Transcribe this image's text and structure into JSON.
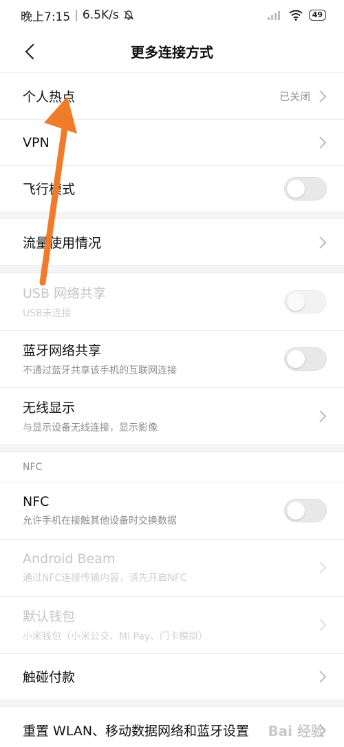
{
  "status_bar": {
    "time": "晚上7:15",
    "separator": "|",
    "speed": "6.5K/s",
    "battery": "49",
    "icons": [
      "mute-bell-icon",
      "signal-icon",
      "wifi-icon",
      "battery-icon"
    ]
  },
  "header": {
    "title": "更多连接方式",
    "back_icon": "back-arrow-icon"
  },
  "group1": {
    "hotspot": {
      "label": "个人热点",
      "value": "已关闭"
    },
    "vpn": {
      "label": "VPN"
    },
    "airplane": {
      "label": "飞行模式",
      "enabled": false
    }
  },
  "group2": {
    "data_usage": {
      "label": "流量使用情况"
    }
  },
  "group3": {
    "usb_tethering": {
      "label": "USB 网络共享",
      "sub": "USB未连接",
      "enabled": false,
      "disabled": true
    },
    "bt_tethering": {
      "label": "蓝牙网络共享",
      "sub": "不通过蓝牙共享该手机的互联网连接",
      "enabled": false
    },
    "wireless_display": {
      "label": "无线显示",
      "sub": "与显示设备无线连接，显示影像"
    }
  },
  "nfc_section": {
    "header": "NFC",
    "nfc": {
      "label": "NFC",
      "sub": "允许手机在接触其他设备时交换数据",
      "enabled": false
    },
    "android_beam": {
      "label": "Android Beam",
      "sub": "通过NFC连接传输内容，请先开启NFC",
      "disabled": true
    },
    "default_wallet": {
      "label": "默认钱包",
      "sub": "小米钱包（小米公交、Mi Pay、门卡模拟）",
      "disabled": true
    },
    "tap_pay": {
      "label": "触碰付款"
    }
  },
  "group5": {
    "reset": {
      "label": "重置 WLAN、移动数据网络和蓝牙设置"
    }
  },
  "watermark": "Bai 经验",
  "colors": {
    "arrow": "#f07c2a",
    "toggle_off": "#e8e8e8",
    "text_secondary": "#8c8c8c"
  }
}
